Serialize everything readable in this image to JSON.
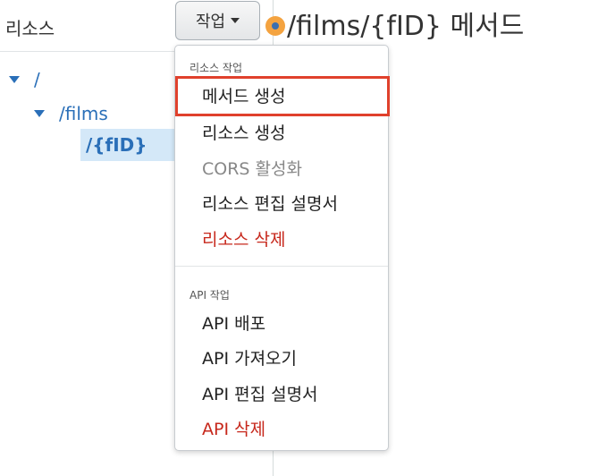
{
  "sidebar": {
    "title": "리소스",
    "tree": {
      "root": "/",
      "films": "/films",
      "fid": "/{fID}"
    }
  },
  "toolbar": {
    "actions_label": "작업"
  },
  "header": {
    "resource_title": "/films/{fID} 메서드"
  },
  "menu": {
    "resource_section_header": "리소스 작업",
    "resource_items": {
      "create_method": "메서드 생성",
      "create_resource": "리소스 생성",
      "enable_cors": "CORS 활성화",
      "edit_docs": "리소스 편집 설명서",
      "delete_resource": "리소스 삭제"
    },
    "api_section_header": "API 작업",
    "api_items": {
      "deploy": "API 배포",
      "import": "API 가져오기",
      "edit_docs": "API 편집 설명서",
      "delete": "API 삭제"
    }
  },
  "colors": {
    "link_blue": "#2a6fb8",
    "selected_bg": "#d4e8f8",
    "danger_red": "#c7281c",
    "highlight_border": "#e0412c",
    "method_dot": "#f4a340"
  }
}
